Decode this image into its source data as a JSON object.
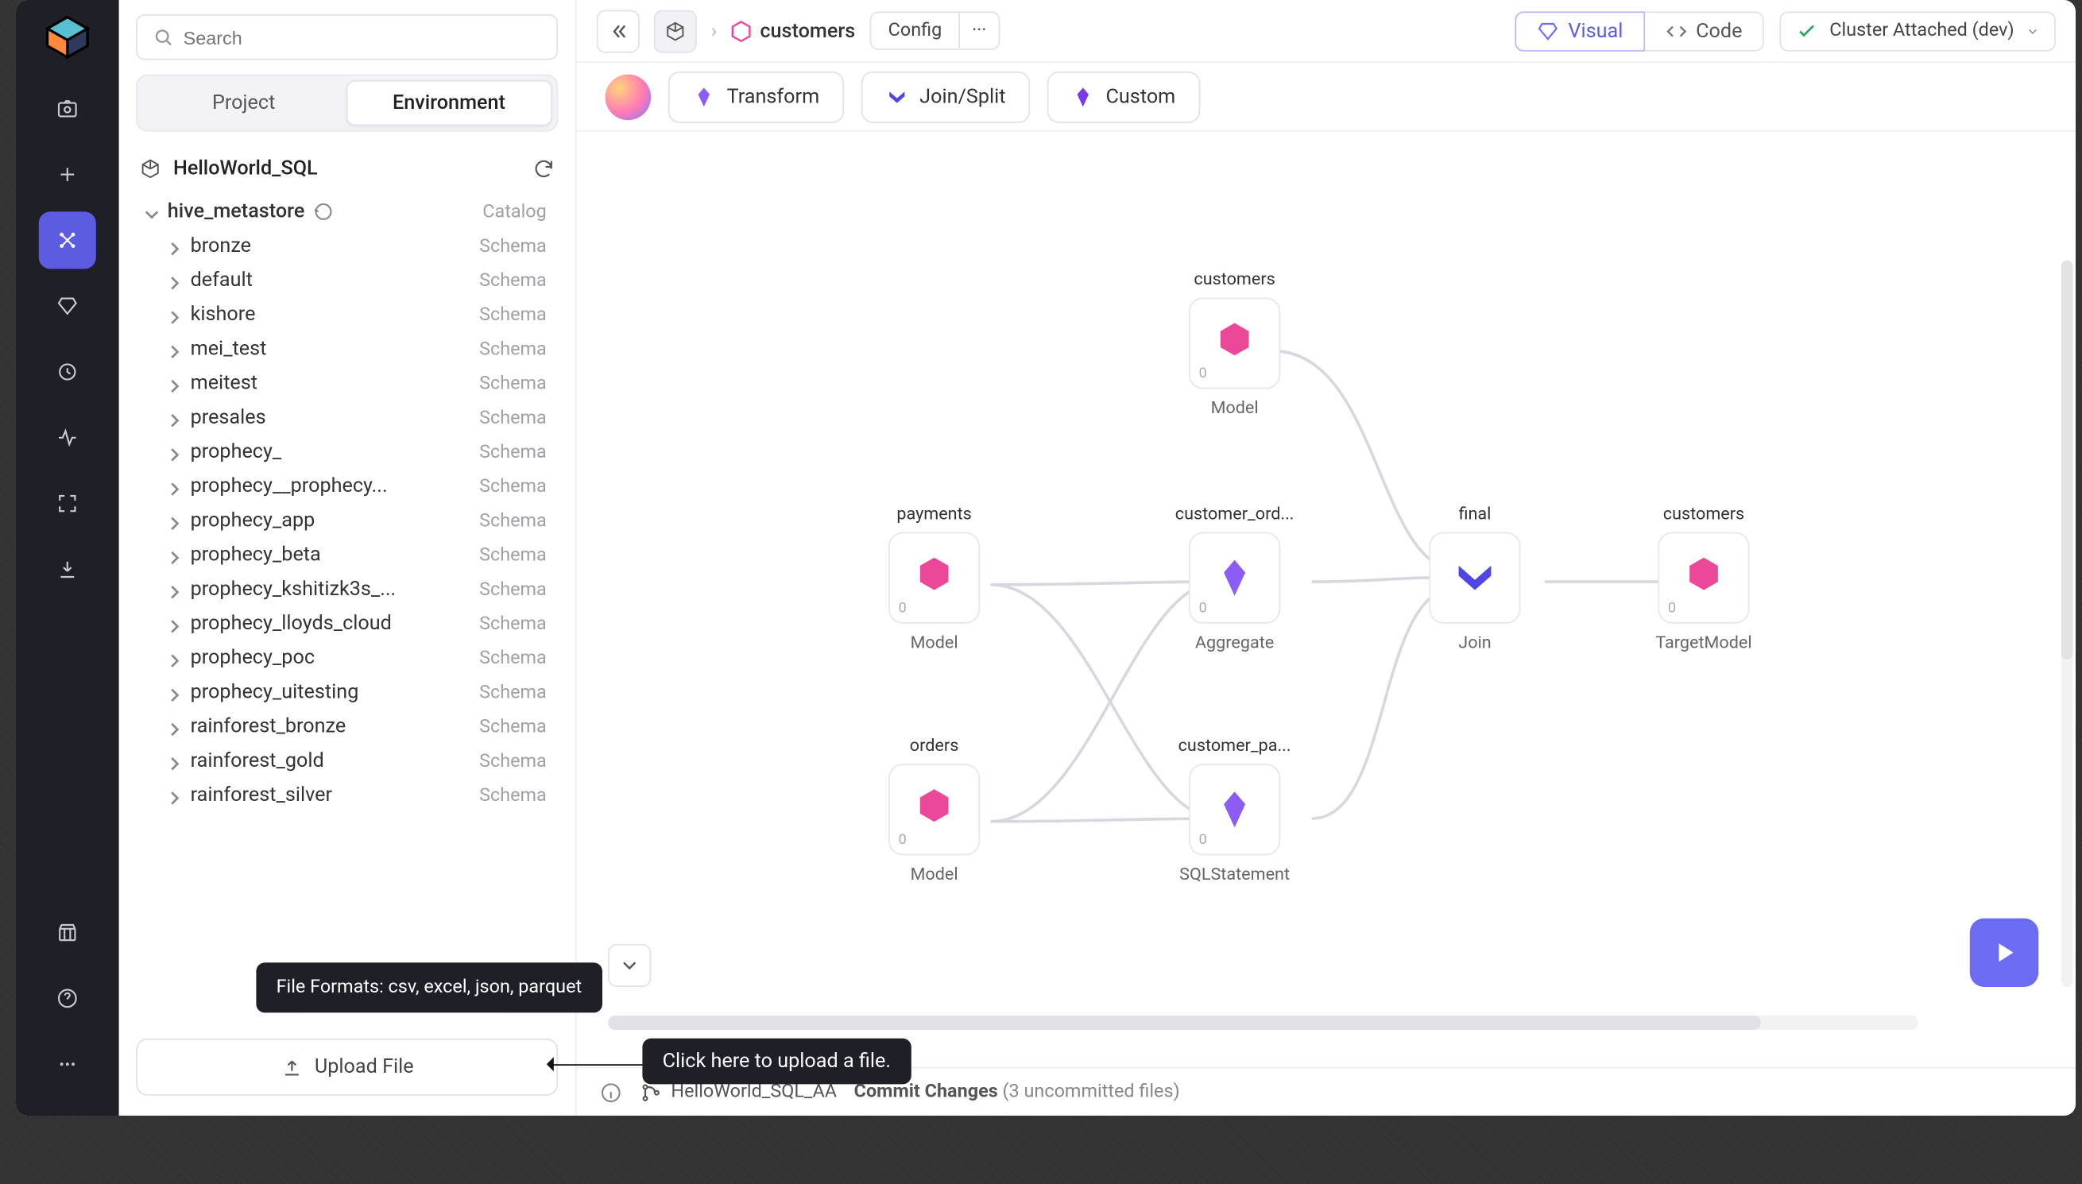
{
  "search": {
    "placeholder": "Search"
  },
  "tabs": {
    "project": "Project",
    "environment": "Environment"
  },
  "project": {
    "name": "HelloWorld_SQL"
  },
  "catalog": {
    "name": "hive_metastore",
    "label": "Catalog"
  },
  "schemas": [
    {
      "name": "bronze",
      "type": "Schema"
    },
    {
      "name": "default",
      "type": "Schema"
    },
    {
      "name": "kishore",
      "type": "Schema"
    },
    {
      "name": "mei_test",
      "type": "Schema"
    },
    {
      "name": "meitest",
      "type": "Schema"
    },
    {
      "name": "presales",
      "type": "Schema"
    },
    {
      "name": "prophecy_",
      "type": "Schema"
    },
    {
      "name": "prophecy__prophecy...",
      "type": "Schema"
    },
    {
      "name": "prophecy_app",
      "type": "Schema"
    },
    {
      "name": "prophecy_beta",
      "type": "Schema"
    },
    {
      "name": "prophecy_kshitizk3s_...",
      "type": "Schema"
    },
    {
      "name": "prophecy_lloyds_cloud",
      "type": "Schema"
    },
    {
      "name": "prophecy_poc",
      "type": "Schema"
    },
    {
      "name": "prophecy_uitesting",
      "type": "Schema"
    },
    {
      "name": "rainforest_bronze",
      "type": "Schema"
    },
    {
      "name": "rainforest_gold",
      "type": "Schema"
    },
    {
      "name": "rainforest_silver",
      "type": "Schema"
    }
  ],
  "tooltip": {
    "formats": "File Formats: csv, excel, json, parquet"
  },
  "upload": {
    "label": "Upload File"
  },
  "crumb": {
    "entity": "customers",
    "config": "Config"
  },
  "view": {
    "visual": "Visual",
    "code": "Code"
  },
  "cluster": {
    "label": "Cluster Attached (dev)"
  },
  "toolbar": {
    "transform": "Transform",
    "joinsplit": "Join/Split",
    "custom": "Custom"
  },
  "nodes": {
    "customers_top": {
      "title": "customers",
      "sub": "Model",
      "zero": "0"
    },
    "payments": {
      "title": "payments",
      "sub": "Model",
      "zero": "0"
    },
    "orders": {
      "title": "orders",
      "sub": "Model",
      "zero": "0"
    },
    "customer_ord": {
      "title": "customer_ord...",
      "sub": "Aggregate",
      "zero": "0"
    },
    "customer_pa": {
      "title": "customer_pa...",
      "sub": "SQLStatement",
      "zero": "0"
    },
    "final": {
      "title": "final",
      "sub": "Join"
    },
    "customers_right": {
      "title": "customers",
      "sub": "TargetModel",
      "zero": "0"
    }
  },
  "footer": {
    "branch": "HelloWorld_SQL_AA",
    "commit_label": "Commit Changes",
    "commit_detail": "(3 uncommitted files)"
  },
  "callout": {
    "text": "Click here to upload a file."
  }
}
